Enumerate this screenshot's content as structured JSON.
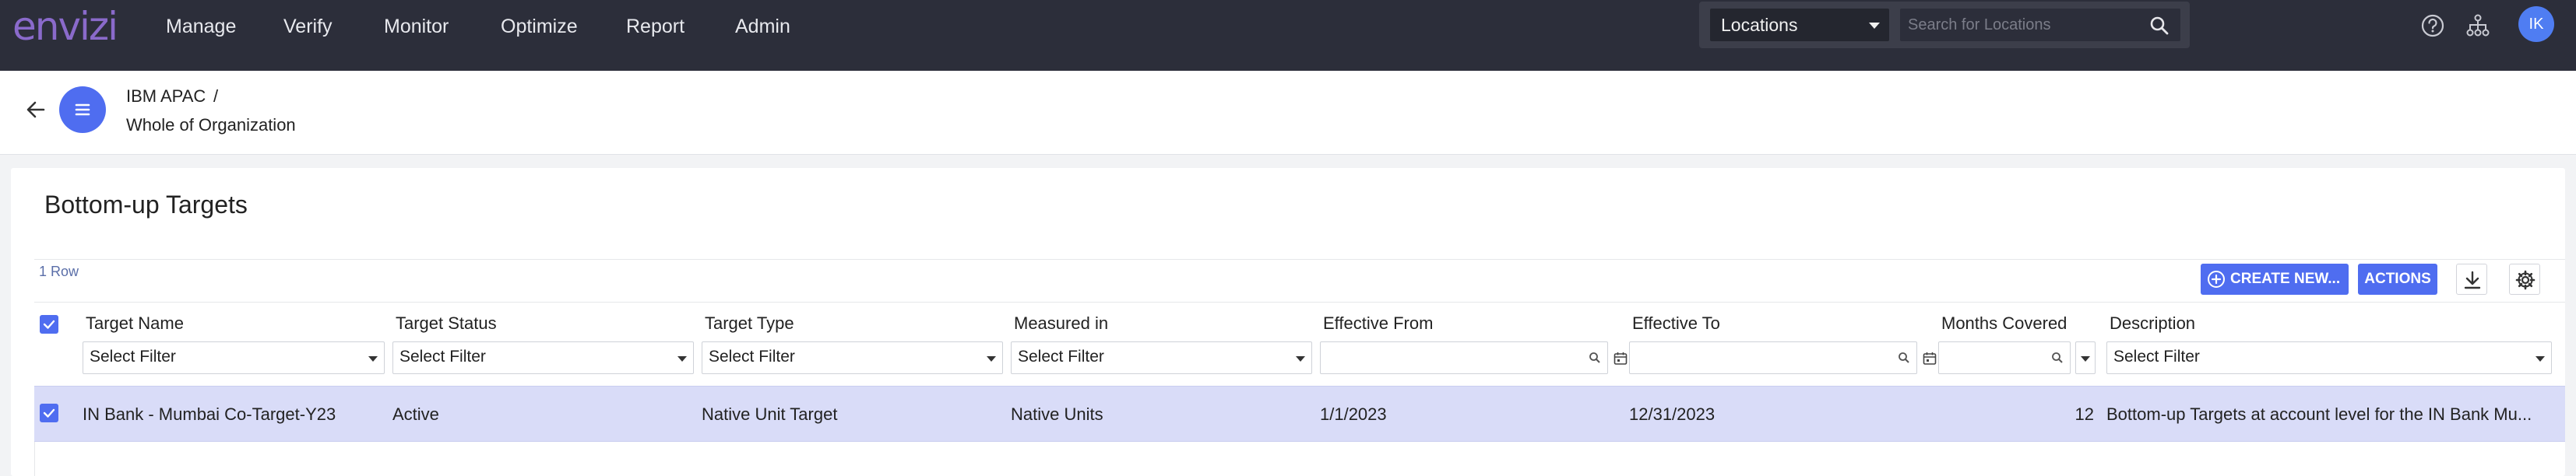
{
  "app": {
    "logo": "envizi"
  },
  "nav": {
    "items": [
      {
        "label": "Manage"
      },
      {
        "label": "Verify"
      },
      {
        "label": "Monitor"
      },
      {
        "label": "Optimize"
      },
      {
        "label": "Report"
      },
      {
        "label": "Admin"
      }
    ]
  },
  "location_search": {
    "selected": "Locations",
    "placeholder": "Search for Locations"
  },
  "user": {
    "initials": "IK"
  },
  "breadcrumb": {
    "parent": "IBM APAC",
    "separator": "/",
    "current": "Whole of Organization"
  },
  "panel": {
    "title": "Bottom-up Targets",
    "row_count": "1 Row",
    "create_label": "CREATE NEW...",
    "actions_label": "ACTIONS"
  },
  "grid": {
    "columns": [
      {
        "title": "Target Name",
        "filter": "Select Filter"
      },
      {
        "title": "Target Status",
        "filter": "Select Filter"
      },
      {
        "title": "Target Type",
        "filter": "Select Filter"
      },
      {
        "title": "Measured in",
        "filter": "Select Filter"
      },
      {
        "title": "Effective From",
        "filter": ""
      },
      {
        "title": "Effective To",
        "filter": ""
      },
      {
        "title": "Months Covered",
        "filter": ""
      },
      {
        "title": "Description",
        "filter": "Select Filter"
      }
    ],
    "rows": [
      {
        "target_name": "IN Bank - Mumbai Co-Target-Y23",
        "target_status": "Active",
        "target_type": "Native Unit Target",
        "measured_in": "Native Units",
        "effective_from": "1/1/2023",
        "effective_to": "12/31/2023",
        "months_covered": "12",
        "description": "Bottom-up Targets at account level for the IN Bank Mu..."
      }
    ]
  },
  "colors": {
    "topnav_bg": "#2c2e3a",
    "accent": "#4f6df0",
    "logo": "#8a6acb",
    "selected_row": "#d9dcf8"
  }
}
